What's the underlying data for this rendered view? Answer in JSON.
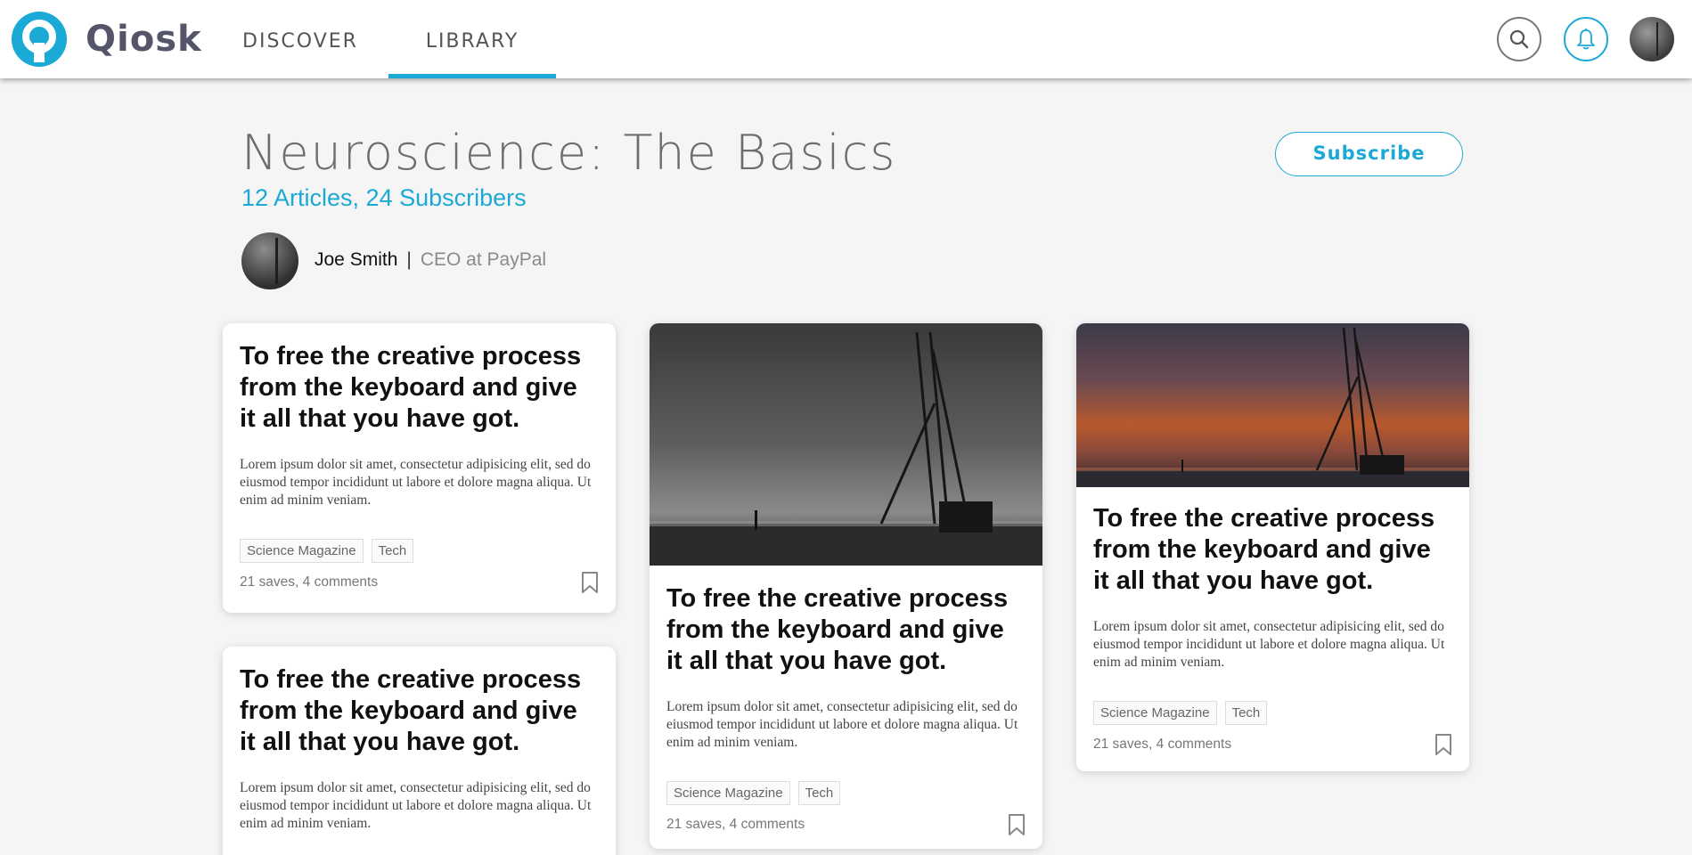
{
  "header": {
    "brand": "Qiosk",
    "tabs": [
      {
        "label": "DISCOVER"
      },
      {
        "label": "LIBRARY",
        "active": true
      }
    ],
    "icons": [
      "search-icon",
      "bell-icon"
    ],
    "accent_color": "#1ba9d6"
  },
  "collection": {
    "title": "Neuroscience: The Basics",
    "stats": "12 Articles, 24 Subscribers",
    "subscribe_label": "Subscribe",
    "author_name": "Joe Smith",
    "separator": "|",
    "author_role": "CEO at PayPal"
  },
  "cards": [
    {
      "title": "To free the creative process from the keyboard and give it all that you have got.",
      "excerpt": "Lorem ipsum dolor sit amet, consectetur adipisicing elit, sed do eiusmod tempor incididunt ut labore et dolore magna aliqua. Ut enim ad minim veniam.",
      "tags": [
        "Science Magazine",
        "Tech"
      ],
      "stats": "21 saves, 4 comments"
    },
    {
      "title": "To free the creative process from the keyboard and give it all that you have got.",
      "excerpt": "Lorem ipsum dolor sit amet, consectetur adipisicing elit, sed do eiusmod tempor incididunt ut labore et dolore magna aliqua. Ut enim ad minim veniam.",
      "tags": [
        "Science Magazine",
        "Tech"
      ],
      "stats": "21 saves, 4 comments"
    },
    {
      "title": "To free the creative process from the keyboard and give it all that you have got.",
      "excerpt": "Lorem ipsum dolor sit amet, consectetur adipisicing elit, sed do eiusmod tempor incididunt ut labore et dolore magna aliqua. Ut enim ad minim veniam.",
      "tags": [
        "Science Magazine",
        "Tech"
      ],
      "stats": "21 saves, 4 comments"
    },
    {
      "title": "To free the creative process from the keyboard and give it all that you have got.",
      "excerpt": "Lorem ipsum dolor sit amet, consectetur adipisicing elit, sed do eiusmod tempor incididunt ut labore et dolore magna aliqua. Ut enim ad minim veniam."
    }
  ]
}
